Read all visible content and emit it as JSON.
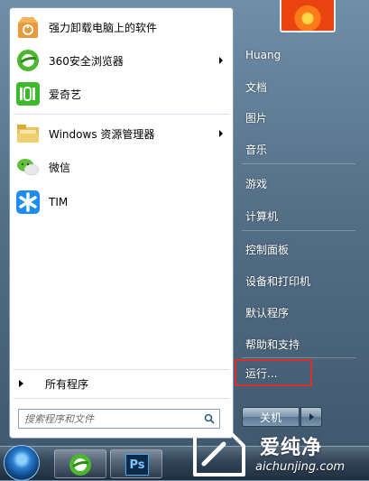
{
  "pinned_programs": [
    {
      "label": "强力卸载电脑上的软件",
      "icon": "uninstaller-icon",
      "submenu": false
    },
    {
      "label": "360安全浏览器",
      "icon": "360-browser-icon",
      "submenu": true
    },
    {
      "label": "爱奇艺",
      "icon": "iqiyi-icon",
      "submenu": false
    }
  ],
  "recent_programs": [
    {
      "label": "Windows 资源管理器",
      "icon": "file-explorer-icon",
      "submenu": true
    },
    {
      "label": "微信",
      "icon": "wechat-icon",
      "submenu": false
    },
    {
      "label": "TIM",
      "icon": "tim-icon",
      "submenu": false
    }
  ],
  "all_programs_label": "所有程序",
  "search": {
    "placeholder": "搜索程序和文件"
  },
  "right_panel": {
    "user": "Huang",
    "documents": "文档",
    "pictures": "图片",
    "music": "音乐",
    "games": "游戏",
    "computer": "计算机",
    "control_panel": "控制面板",
    "devices_printers": "设备和打印机",
    "default_programs": "默认程序",
    "help_support": "帮助和支持",
    "run": "运行..."
  },
  "shutdown_label": "关机",
  "taskbar": {
    "items": [
      "start-orb-icon",
      "360-browser-icon",
      "photoshop-icon"
    ],
    "ps_label": "Ps"
  },
  "watermark": {
    "name": "爱纯净",
    "url": "aichunjing.com"
  },
  "colors": {
    "highlight": "#d9302c",
    "panel_blue": "#536f86"
  }
}
